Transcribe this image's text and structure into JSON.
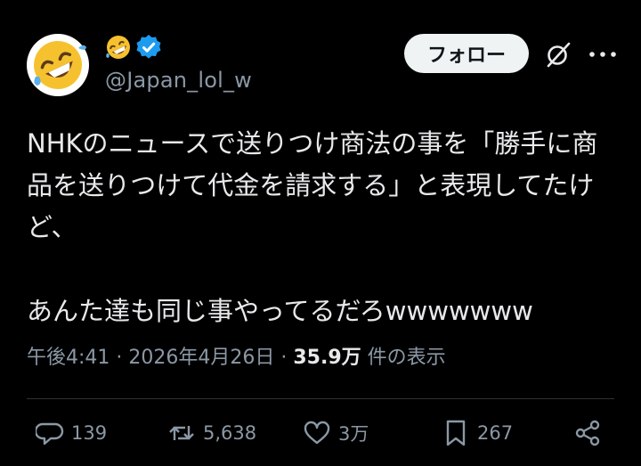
{
  "author": {
    "handle": "@Japan_lol_w",
    "avatar_icon": "rolling-on-floor-laughing-emoji",
    "name_icon": "rolling-on-floor-laughing-emoji",
    "verified_icon": "verified-badge-icon"
  },
  "header": {
    "follow_label": "フォロー",
    "grok_icon": "grok-icon",
    "more_icon": "more-icon"
  },
  "tweet": {
    "line1": "NHKのニュースで送りつけ商法の事を「勝手に商",
    "line2": "品を送りつけて代金を請求する」と表現してたけ",
    "line3": "ど、",
    "line4": "あんた達も同じ事やってるだろwwwwwww"
  },
  "meta": {
    "time": "午後4:41",
    "sep1": " · ",
    "date": "2026年4月26日",
    "sep2": " · ",
    "views_count": "35.9万",
    "views_label": " 件の表示"
  },
  "actions": {
    "replies": "139",
    "reposts": "5,638",
    "likes": "3万",
    "bookmarks": "267"
  },
  "colors": {
    "background": "#000000",
    "text": "#e7e9ea",
    "secondary": "#8b98a5",
    "verified_blue": "#1d9bf0",
    "button_bg": "#eff3f4"
  }
}
